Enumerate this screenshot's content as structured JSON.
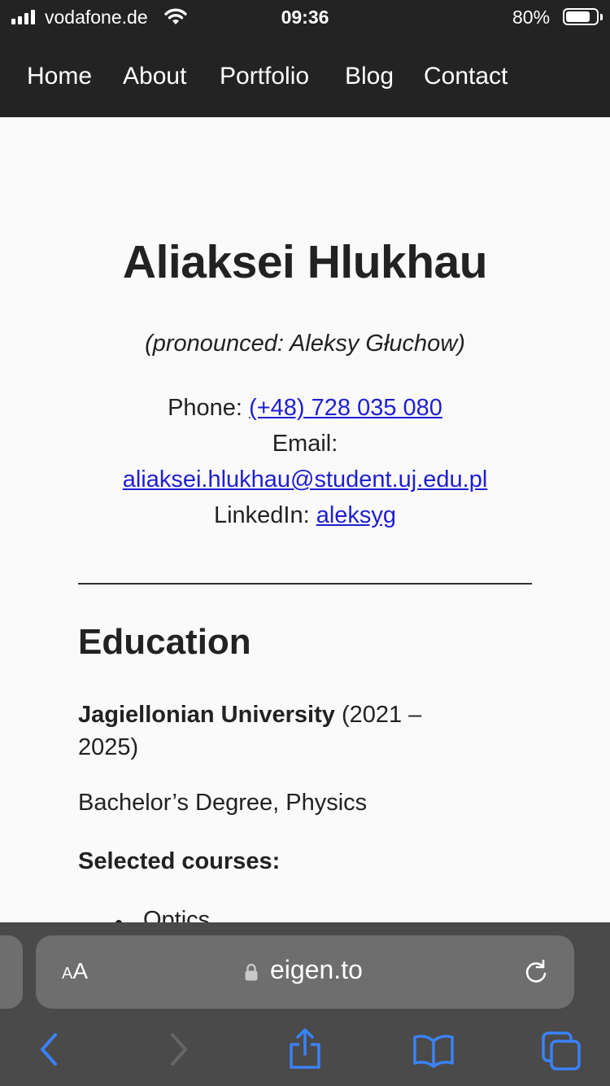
{
  "status": {
    "carrier": "vodafone.de",
    "time": "09:36",
    "battery": "80%",
    "battery_level": 0.8
  },
  "nav": {
    "items": [
      "Home",
      "About",
      "Portfolio",
      "Blog",
      "Contact"
    ]
  },
  "profile": {
    "name": "Aliaksei Hlukhau",
    "pronounced": "(pronounced: Aleksy Głuchow)",
    "phone_label": "Phone: ",
    "phone": "(+48) 728 035 080",
    "email_label": "Email:",
    "email": "aliaksei.hlukhau@student.uj.edu.pl",
    "linkedin_label": "LinkedIn: ",
    "linkedin": "aleksyg"
  },
  "education": {
    "heading": "Education",
    "university": "Jagiellonian University",
    "years_a": " (2021 –",
    "years_b": "2025)",
    "degree": "Bachelor’s Degree, Physics",
    "courses_heading": "Selected courses:",
    "courses": [
      "Optics"
    ]
  },
  "browser": {
    "text_size_label_small": "A",
    "text_size_label_large": "A",
    "url": "eigen.to",
    "icons": [
      "lock-icon",
      "reload-icon",
      "back-icon",
      "forward-icon",
      "share-icon",
      "bookmarks-icon",
      "tabs-icon"
    ],
    "accent": "#3a82f7"
  }
}
